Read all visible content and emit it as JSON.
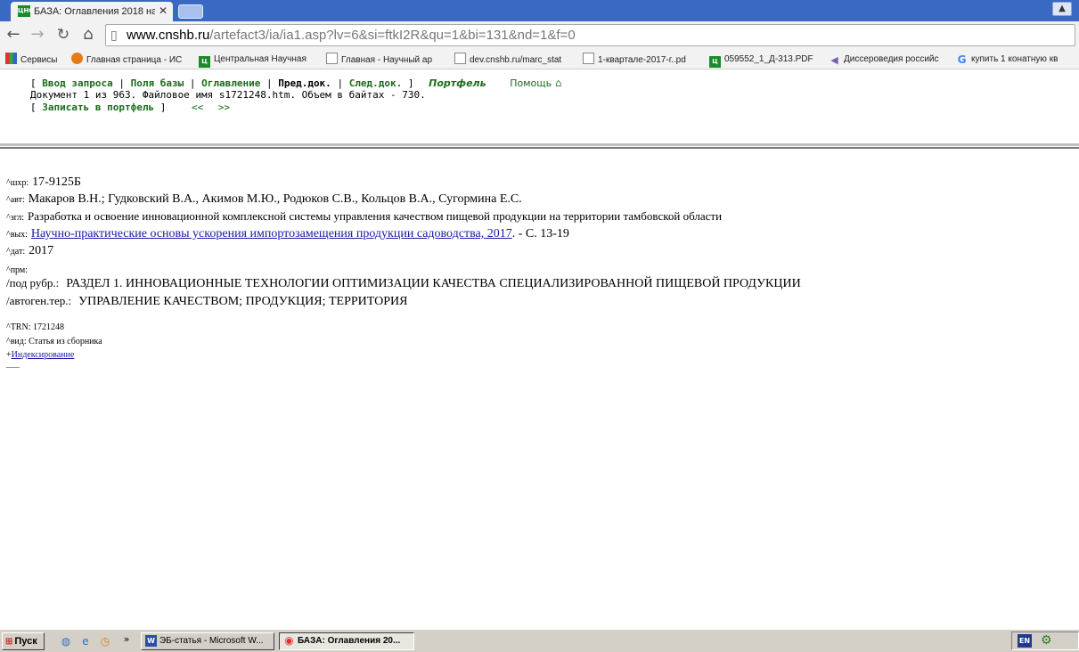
{
  "browser": {
    "tab_title": "БАЗА: Оглавления 2018 на",
    "tab_favicon": "ЦНСХБ",
    "close_glyph": "✕",
    "url_host": "www.cnshb.ru",
    "url_path": "/artefact3/ia/ia1.asp?lv=6&si=ftkI2R&qu=1&bi=131&nd=1&f=0"
  },
  "bookmarks": [
    {
      "label": "Сервисы",
      "icon": "apps-icon"
    },
    {
      "label": "Главная страница - ИС",
      "icon": "orange-circle-icon"
    },
    {
      "label": "Центральная Научная",
      "icon": "cnshb-icon"
    },
    {
      "label": "Главная - Научный ар",
      "icon": "doc-icon"
    },
    {
      "label": "dev.cnshb.ru/marc_stat",
      "icon": "page-icon"
    },
    {
      "label": "1-квартале-2017-г..pd",
      "icon": "page-icon"
    },
    {
      "label": "059552_1_Д-313.PDF",
      "icon": "cnshb-icon"
    },
    {
      "label": "Диссероведия российс",
      "icon": "purple-arrow-icon"
    },
    {
      "label": "купить 1 конатную кв",
      "icon": "google-icon"
    }
  ],
  "nav": {
    "line1": {
      "bracket_open": "[",
      "query": "Ввод запроса",
      "sep1": "|",
      "fields": "Поля базы",
      "sep2": "|",
      "toc": "Оглавление",
      "sep3": "|",
      "prev": "Пред.док.",
      "sep4": "|",
      "next": "След.док.",
      "bracket_close": "]",
      "portfolio": "Портфель",
      "help": "Помощь"
    },
    "line2": "Документ 1 из 963. Файловое имя s1721248.htm. Объем в байтах - 730.",
    "line3": {
      "bracket_open": "[",
      "save": "Записать в портфель",
      "bracket_close": "]",
      "prev_arrows": "<<",
      "next_arrows": ">>"
    }
  },
  "record": {
    "shkhr_tag": "^шхр:",
    "shkhr_val": "17-9125Б",
    "avt_tag": "^авт:",
    "avt_val": "Макаров В.Н.; Гудковский В.А., Акимов М.Ю., Родюков С.В., Кольцов В.А., Сугормина Е.С.",
    "zgl_tag": "^згл:",
    "zgl_val": "Разработка и освоение инновационной комплексной системы управления качеством пищевой продукции на территории тамбовской области",
    "vykh_tag": "^вых:",
    "vykh_link": "Научно-практические основы ускорения импортозамещения продукции садоводства, 2017",
    "vykh_rest": ". - С. 13-19",
    "dat_tag": "^дат:",
    "dat_val": "2017",
    "prm_tag": "^прм:",
    "pod_rubr_tag": "/под рубр.:",
    "pod_rubr_val": "РАЗДЕЛ 1. ИННОВАЦИОННЫЕ ТЕХНОЛОГИИ ОПТИМИЗАЦИИ КАЧЕСТВА СПЕЦИАЛИЗИРОВАННОЙ ПИЩЕВОЙ ПРОДУКЦИИ",
    "avtogen_tag": "/автоген.тер.:",
    "avtogen_val": "УПРАВЛЕНИЕ КАЧЕСТВОМ; ПРОДУКЦИЯ; ТЕРРИТОРИЯ",
    "trn_line": "^TRN: 1721248",
    "vid_line": "^вид: Статья из сборника",
    "index_prefix": "+",
    "index_link": "Индексирование",
    "trail_link": "___"
  },
  "taskbar": {
    "start_label": "Пуск",
    "chevron": "»",
    "word_label": "ЭБ-статья - Microsoft W...",
    "chrome_label": "БАЗА: Оглавления 20...",
    "lang": "EN"
  }
}
